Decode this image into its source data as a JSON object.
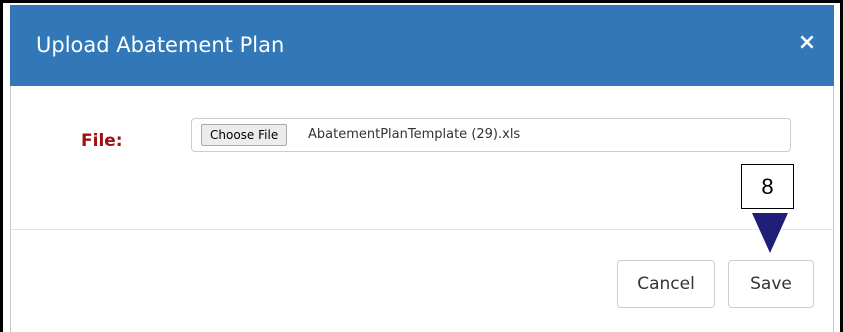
{
  "dialog": {
    "title": "Upload Abatement Plan",
    "close_symbol": "×",
    "file_label": "File:",
    "choose_file_label": "Choose File",
    "file_name": "AbatementPlanTemplate (29).xls",
    "cancel_label": "Cancel",
    "save_label": "Save"
  },
  "callout": {
    "step_number": "8",
    "arrow_color": "#1f1f7a"
  },
  "colors": {
    "header": "#3277b7",
    "label_red": "#a01010"
  }
}
